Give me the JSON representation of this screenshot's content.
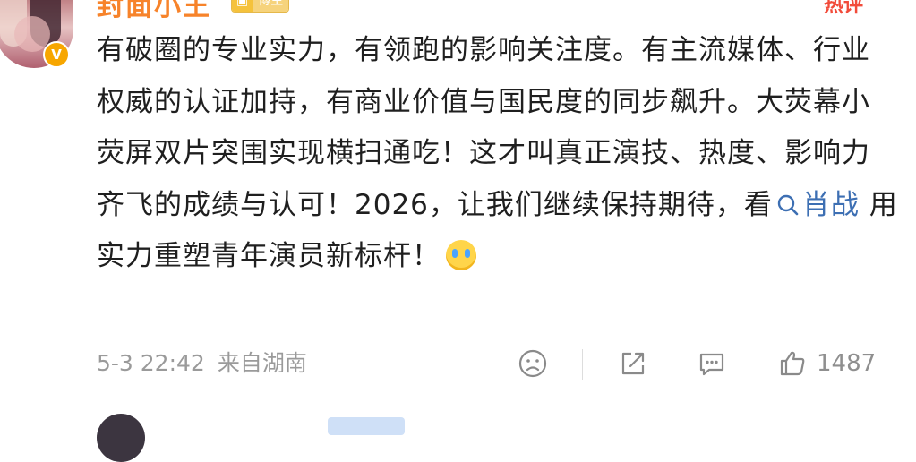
{
  "header": {
    "username": "封面小王",
    "level_badge_text": "博主",
    "level_badge_icon": "lv-icon",
    "hot_tag": "热评"
  },
  "avatar": {
    "verified_icon": "v-verified-icon",
    "verified_mark": "V",
    "verified_color": "#f7a600"
  },
  "post": {
    "text_before": "有破圈的专业实力，有领跑的影响关注度。有主流媒体、行业权威的认证加持，有商业价值与国民度的同步飙升。大荧幕小荧屏双片突围实现横扫通吃！这才叫真正演技、热度、影响力齐飞的成绩与认可！2026，让我们继续保持期待，看",
    "topic_icon": "search-icon",
    "topic_text": "肖战",
    "text_after": " 用实力重塑青年演员新标杆！",
    "emoji": "crying-laughing-emoji-icon"
  },
  "meta": {
    "time": "5-3 22:42",
    "source": "来自湖南"
  },
  "actions": {
    "dislike_icon": "frown-face-icon",
    "share_icon": "share-icon",
    "comment_icon": "comment-icon",
    "like_icon": "thumbs-up-icon",
    "like_count": "1487"
  },
  "colors": {
    "accent_topic": "#3d6fb3",
    "username": "#f7832a",
    "meta_gray": "#9a9a9a"
  }
}
